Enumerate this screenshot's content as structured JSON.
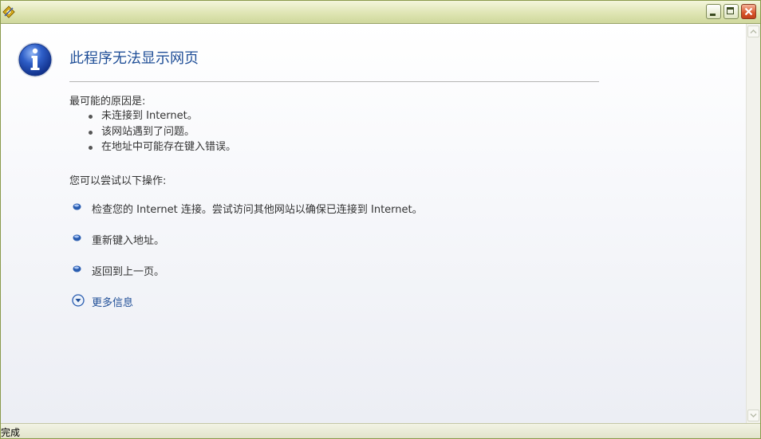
{
  "window": {
    "status_text": "完成"
  },
  "page": {
    "title": "此程序无法显示网页",
    "causes_heading": "最可能的原因是:",
    "causes": [
      "未连接到 Internet。",
      "该网站遇到了问题。",
      "在地址中可能存在键入错误。"
    ],
    "try_heading": "您可以尝试以下操作:",
    "actions": [
      "检查您的 Internet 连接。尝试访问其他网站以确保已连接到 Internet。",
      "重新键入地址。",
      "返回到上一页。"
    ],
    "more_info_label": "更多信息"
  },
  "icons": {
    "app": "ie-diamond-icon",
    "info": "info-icon",
    "more": "chevron-down-circle-icon"
  },
  "colors": {
    "title_blue": "#1f4e97",
    "bullet_blue": "#2a5db0",
    "close_red": "#d8542a"
  }
}
